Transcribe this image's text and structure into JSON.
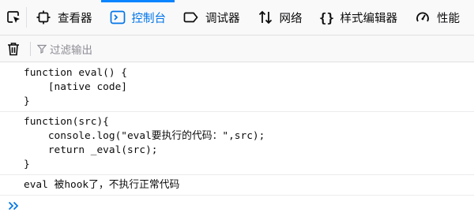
{
  "toolbar": {
    "tabs": [
      {
        "label": "查看器"
      },
      {
        "label": "控制台"
      },
      {
        "label": "调试器"
      },
      {
        "label": "网络"
      },
      {
        "label": "样式编辑器"
      },
      {
        "label": "性能"
      }
    ],
    "selected_tab": "控制台",
    "accent_color": "#0074e8"
  },
  "filterbar": {
    "filter_placeholder": "过滤输出"
  },
  "console": {
    "messages": [
      {
        "lines": [
          "function eval() {",
          "    [native code]",
          "}"
        ]
      },
      {
        "lines": [
          "function(src){",
          "    console.log(\"eval要执行的代码：\",src);",
          "    return _eval(src);",
          "}"
        ]
      },
      {
        "lines": [
          "eval 被hook了，不执行正常代码"
        ]
      }
    ]
  }
}
